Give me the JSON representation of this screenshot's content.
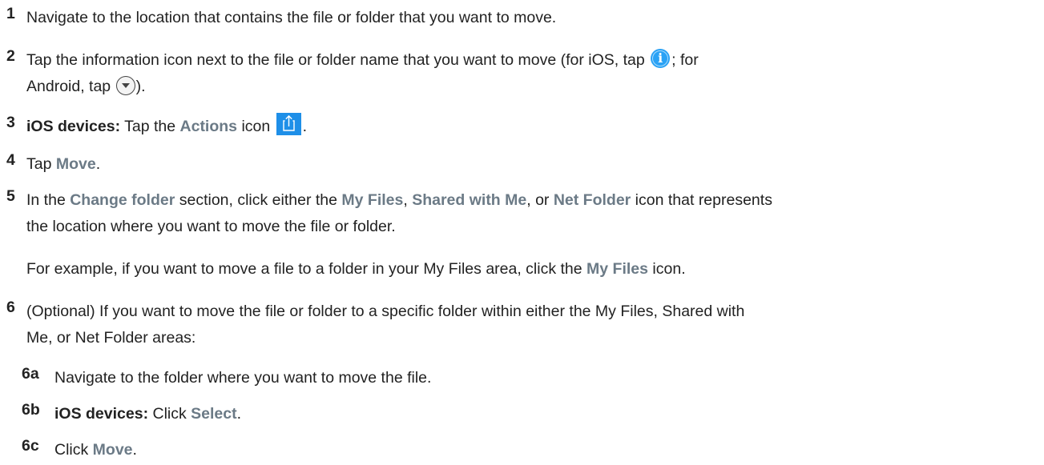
{
  "steps": [
    {
      "num": "1",
      "text": "Navigate to the location that contains the file or folder that you want to move."
    },
    {
      "num": "2",
      "line1_a": "Tap the information icon next to the file or folder name that you want to move (for iOS, tap ",
      "line1_b": "; for",
      "line2_a": "Android, tap ",
      "line2_b": ").",
      "icons": [
        "info-icon",
        "dropdown-circle-icon"
      ]
    },
    {
      "num": "3",
      "bold_prefix": "iOS devices:",
      "text_a": " Tap the ",
      "ui_term": "Actions",
      "text_b": " icon ",
      "text_c": ".",
      "icon": "share-actions-icon"
    },
    {
      "num": "4",
      "text_a": "Tap ",
      "ui_term": "Move",
      "text_b": "."
    },
    {
      "num": "5",
      "a": "In the ",
      "ui1": "Change folder",
      "b": " section, click either the ",
      "ui2": "My Files",
      "c": ", ",
      "ui3": "Shared with Me",
      "d": ", or ",
      "ui4": "Net Folder",
      "e": " icon that represents",
      "line2": "the location where you want to move the file or folder."
    },
    {
      "example_a": "For example, if you want to move a file to a folder in your My Files area, click the ",
      "example_ui": "My Files",
      "example_b": " icon."
    },
    {
      "num": "6",
      "line1": "(Optional) If you want to move the file or folder to a specific folder within either the My Files, Shared with",
      "line2": "Me, or Net Folder areas:"
    }
  ],
  "substeps": [
    {
      "num": "6a",
      "text": "Navigate to the folder where you want to move the file."
    },
    {
      "num": "6b",
      "bold_prefix": "iOS devices:",
      "text_a": " Click ",
      "ui_term": "Select",
      "text_b": "."
    },
    {
      "num": "6c",
      "text_a": "Click ",
      "ui_term": "Move",
      "text_b": "."
    }
  ],
  "colors": {
    "text": "#222222",
    "ui_term": "#6b7a86",
    "info_icon": "#2aa2f5",
    "actions_icon": "#1e8fe8"
  }
}
